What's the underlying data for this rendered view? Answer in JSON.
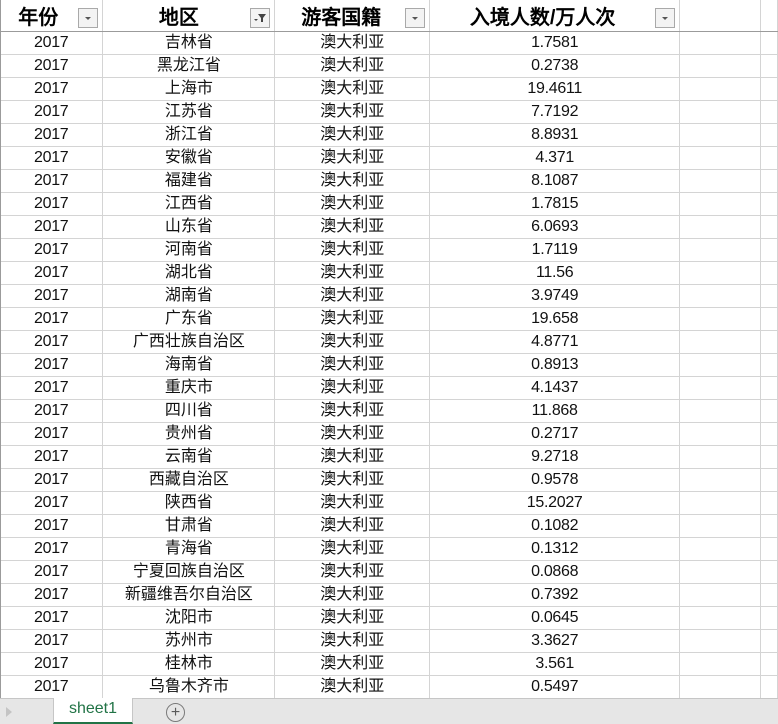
{
  "sheet": {
    "headers": [
      {
        "label": "年份",
        "filter": "dropdown"
      },
      {
        "label": "地区",
        "filter": "filtered"
      },
      {
        "label": "游客国籍",
        "filter": "dropdown"
      },
      {
        "label": "入境人数/万人次",
        "filter": "dropdown"
      }
    ],
    "rows": [
      [
        "2017",
        "吉林省",
        "澳大利亚",
        "1.7581"
      ],
      [
        "2017",
        "黑龙江省",
        "澳大利亚",
        "0.2738"
      ],
      [
        "2017",
        "上海市",
        "澳大利亚",
        "19.4611"
      ],
      [
        "2017",
        "江苏省",
        "澳大利亚",
        "7.7192"
      ],
      [
        "2017",
        "浙江省",
        "澳大利亚",
        "8.8931"
      ],
      [
        "2017",
        "安徽省",
        "澳大利亚",
        "4.371"
      ],
      [
        "2017",
        "福建省",
        "澳大利亚",
        "8.1087"
      ],
      [
        "2017",
        "江西省",
        "澳大利亚",
        "1.7815"
      ],
      [
        "2017",
        "山东省",
        "澳大利亚",
        "6.0693"
      ],
      [
        "2017",
        "河南省",
        "澳大利亚",
        "1.7119"
      ],
      [
        "2017",
        "湖北省",
        "澳大利亚",
        "11.56"
      ],
      [
        "2017",
        "湖南省",
        "澳大利亚",
        "3.9749"
      ],
      [
        "2017",
        "广东省",
        "澳大利亚",
        "19.658"
      ],
      [
        "2017",
        "广西壮族自治区",
        "澳大利亚",
        "4.8771"
      ],
      [
        "2017",
        "海南省",
        "澳大利亚",
        "0.8913"
      ],
      [
        "2017",
        "重庆市",
        "澳大利亚",
        "4.1437"
      ],
      [
        "2017",
        "四川省",
        "澳大利亚",
        "11.868"
      ],
      [
        "2017",
        "贵州省",
        "澳大利亚",
        "0.2717"
      ],
      [
        "2017",
        "云南省",
        "澳大利亚",
        "9.2718"
      ],
      [
        "2017",
        "西藏自治区",
        "澳大利亚",
        "0.9578"
      ],
      [
        "2017",
        "陕西省",
        "澳大利亚",
        "15.2027"
      ],
      [
        "2017",
        "甘肃省",
        "澳大利亚",
        "0.1082"
      ],
      [
        "2017",
        "青海省",
        "澳大利亚",
        "0.1312"
      ],
      [
        "2017",
        "宁夏回族自治区",
        "澳大利亚",
        "0.0868"
      ],
      [
        "2017",
        "新疆维吾尔自治区",
        "澳大利亚",
        "0.7392"
      ],
      [
        "2017",
        "沈阳市",
        "澳大利亚",
        "0.0645"
      ],
      [
        "2017",
        "苏州市",
        "澳大利亚",
        "3.3627"
      ],
      [
        "2017",
        "桂林市",
        "澳大利亚",
        "3.561"
      ],
      [
        "2017",
        "乌鲁木齐市",
        "澳大利亚",
        "0.5497"
      ]
    ]
  },
  "tabs": {
    "sheets": [
      "sheet1"
    ],
    "active": "sheet1",
    "add_icon": "plus-circle-icon",
    "scroll_icon": "triangle-right-icon"
  },
  "colors": {
    "accent": "#217346",
    "grid_line": "#d4d4d4",
    "tabbar_bg": "#e6e6e6"
  }
}
